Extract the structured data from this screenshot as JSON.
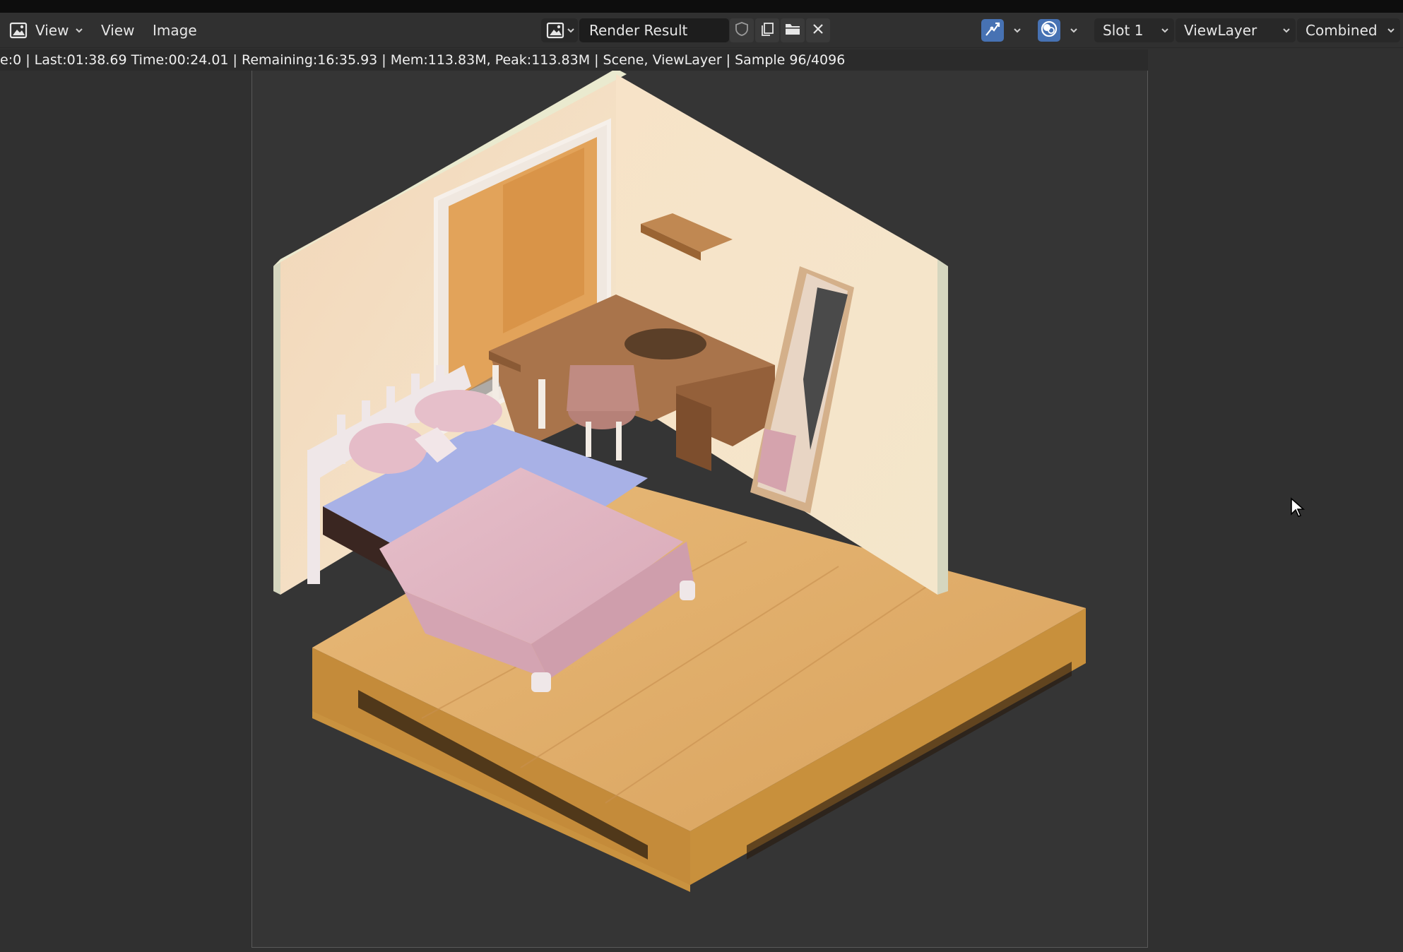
{
  "header": {
    "editor_type_icon": "image-editor-icon",
    "view_dropdown_label": "View",
    "menus": [
      "View",
      "Image"
    ],
    "image_name": "Render Result",
    "slot": "Slot 1",
    "view_layer": "ViewLayer",
    "pass": "Combined",
    "icons": {
      "image_browse": "image-icon",
      "fake_user": "shield-icon",
      "duplicate": "duplicate-icon",
      "open": "folder-icon",
      "unlink": "close-icon",
      "sample_tool": "sample-tool-icon",
      "display_channels": "color-channels-icon"
    }
  },
  "status": {
    "text": "e:0 | Last:01:38.69 Time:00:24.01 | Remaining:16:35.93 | Mem:113.83M, Peak:113.83M | Scene, ViewLayer | Sample 96/4096"
  },
  "colors": {
    "accent": "#4772b3",
    "header_bg": "#303030",
    "field_bg": "#282828"
  }
}
